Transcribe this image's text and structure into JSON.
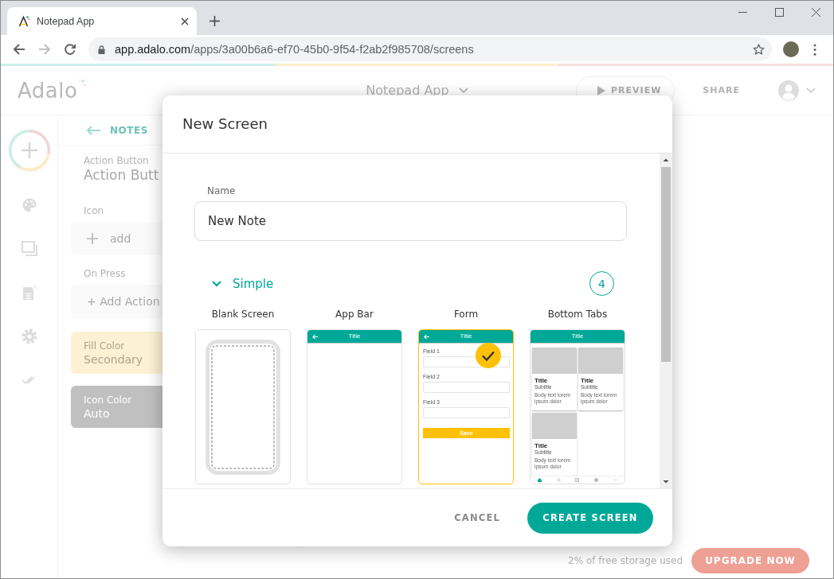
{
  "browser": {
    "tab": {
      "title": "Notepad App"
    },
    "address": {
      "host": "app.adalo.com",
      "path": "/apps/3a00b6a6-ef70-45b0-9f54-f2ab2f985708/screens"
    }
  },
  "editor": {
    "logo": "Adalo",
    "project": "Notepad App",
    "header_actions": [
      {
        "kind": "preview",
        "label": "PREVIEW"
      },
      {
        "kind": "share",
        "label": "SHARE"
      }
    ],
    "back_link": "NOTES",
    "component_type": "Action Button",
    "component_name": "Action Butt",
    "properties": [
      {
        "kind": "picker",
        "label": "Icon",
        "value": "add"
      },
      {
        "kind": "action",
        "label": "On Press",
        "value": "+ Add Action"
      },
      {
        "kind": "color",
        "label": "Fill Color",
        "value": "Secondary",
        "color": "#fcf1d2"
      },
      {
        "kind": "color",
        "label": "Icon Color",
        "value": "Auto",
        "color": "#c0c0c0"
      }
    ],
    "storage": "2% of free storage used",
    "upgrade": "UPGRADE NOW"
  },
  "dialog": {
    "title": "New Screen",
    "name": {
      "label": "Name",
      "value": "New Note"
    },
    "section": {
      "label": "Simple",
      "expanded": true,
      "count": "4"
    },
    "templates": [
      {
        "kind": "blank",
        "label": "Blank Screen",
        "selected": false
      },
      {
        "kind": "app_bar",
        "label": "App Bar",
        "selected": false,
        "bar_title": "Title"
      },
      {
        "kind": "form",
        "label": "Form",
        "selected": true,
        "bar_title": "Title",
        "fields": [
          "Field 1",
          "Field 2",
          "Field 3"
        ],
        "button": "Save"
      },
      {
        "kind": "tabs",
        "label": "Bottom Tabs",
        "selected": false,
        "bar_title": "Title",
        "cards": [
          {
            "title": "Title",
            "subtitle": "Subtitle",
            "body": "Body text lorem ipsum dolor"
          },
          {
            "title": "Title",
            "subtitle": "Subtitle",
            "body": "Body text lorem ipsum dolor"
          },
          {
            "title": "Title",
            "subtitle": "Subtitle",
            "body": "Body text lorem ipsum dolor"
          }
        ]
      }
    ],
    "buttons": [
      {
        "kind": "text",
        "label": "CANCEL"
      },
      {
        "kind": "primary",
        "label": "CREATE SCREEN"
      }
    ]
  }
}
